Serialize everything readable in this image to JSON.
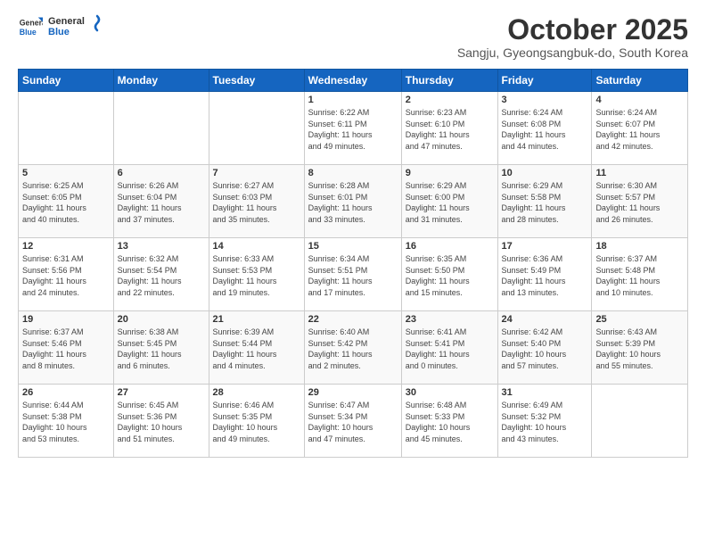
{
  "header": {
    "logo_general": "General",
    "logo_blue": "Blue",
    "month": "October 2025",
    "location": "Sangju, Gyeongsangbuk-do, South Korea"
  },
  "weekdays": [
    "Sunday",
    "Monday",
    "Tuesday",
    "Wednesday",
    "Thursday",
    "Friday",
    "Saturday"
  ],
  "weeks": [
    [
      {
        "day": "",
        "info": ""
      },
      {
        "day": "",
        "info": ""
      },
      {
        "day": "",
        "info": ""
      },
      {
        "day": "1",
        "info": "Sunrise: 6:22 AM\nSunset: 6:11 PM\nDaylight: 11 hours\nand 49 minutes."
      },
      {
        "day": "2",
        "info": "Sunrise: 6:23 AM\nSunset: 6:10 PM\nDaylight: 11 hours\nand 47 minutes."
      },
      {
        "day": "3",
        "info": "Sunrise: 6:24 AM\nSunset: 6:08 PM\nDaylight: 11 hours\nand 44 minutes."
      },
      {
        "day": "4",
        "info": "Sunrise: 6:24 AM\nSunset: 6:07 PM\nDaylight: 11 hours\nand 42 minutes."
      }
    ],
    [
      {
        "day": "5",
        "info": "Sunrise: 6:25 AM\nSunset: 6:05 PM\nDaylight: 11 hours\nand 40 minutes."
      },
      {
        "day": "6",
        "info": "Sunrise: 6:26 AM\nSunset: 6:04 PM\nDaylight: 11 hours\nand 37 minutes."
      },
      {
        "day": "7",
        "info": "Sunrise: 6:27 AM\nSunset: 6:03 PM\nDaylight: 11 hours\nand 35 minutes."
      },
      {
        "day": "8",
        "info": "Sunrise: 6:28 AM\nSunset: 6:01 PM\nDaylight: 11 hours\nand 33 minutes."
      },
      {
        "day": "9",
        "info": "Sunrise: 6:29 AM\nSunset: 6:00 PM\nDaylight: 11 hours\nand 31 minutes."
      },
      {
        "day": "10",
        "info": "Sunrise: 6:29 AM\nSunset: 5:58 PM\nDaylight: 11 hours\nand 28 minutes."
      },
      {
        "day": "11",
        "info": "Sunrise: 6:30 AM\nSunset: 5:57 PM\nDaylight: 11 hours\nand 26 minutes."
      }
    ],
    [
      {
        "day": "12",
        "info": "Sunrise: 6:31 AM\nSunset: 5:56 PM\nDaylight: 11 hours\nand 24 minutes."
      },
      {
        "day": "13",
        "info": "Sunrise: 6:32 AM\nSunset: 5:54 PM\nDaylight: 11 hours\nand 22 minutes."
      },
      {
        "day": "14",
        "info": "Sunrise: 6:33 AM\nSunset: 5:53 PM\nDaylight: 11 hours\nand 19 minutes."
      },
      {
        "day": "15",
        "info": "Sunrise: 6:34 AM\nSunset: 5:51 PM\nDaylight: 11 hours\nand 17 minutes."
      },
      {
        "day": "16",
        "info": "Sunrise: 6:35 AM\nSunset: 5:50 PM\nDaylight: 11 hours\nand 15 minutes."
      },
      {
        "day": "17",
        "info": "Sunrise: 6:36 AM\nSunset: 5:49 PM\nDaylight: 11 hours\nand 13 minutes."
      },
      {
        "day": "18",
        "info": "Sunrise: 6:37 AM\nSunset: 5:48 PM\nDaylight: 11 hours\nand 10 minutes."
      }
    ],
    [
      {
        "day": "19",
        "info": "Sunrise: 6:37 AM\nSunset: 5:46 PM\nDaylight: 11 hours\nand 8 minutes."
      },
      {
        "day": "20",
        "info": "Sunrise: 6:38 AM\nSunset: 5:45 PM\nDaylight: 11 hours\nand 6 minutes."
      },
      {
        "day": "21",
        "info": "Sunrise: 6:39 AM\nSunset: 5:44 PM\nDaylight: 11 hours\nand 4 minutes."
      },
      {
        "day": "22",
        "info": "Sunrise: 6:40 AM\nSunset: 5:42 PM\nDaylight: 11 hours\nand 2 minutes."
      },
      {
        "day": "23",
        "info": "Sunrise: 6:41 AM\nSunset: 5:41 PM\nDaylight: 11 hours\nand 0 minutes."
      },
      {
        "day": "24",
        "info": "Sunrise: 6:42 AM\nSunset: 5:40 PM\nDaylight: 10 hours\nand 57 minutes."
      },
      {
        "day": "25",
        "info": "Sunrise: 6:43 AM\nSunset: 5:39 PM\nDaylight: 10 hours\nand 55 minutes."
      }
    ],
    [
      {
        "day": "26",
        "info": "Sunrise: 6:44 AM\nSunset: 5:38 PM\nDaylight: 10 hours\nand 53 minutes."
      },
      {
        "day": "27",
        "info": "Sunrise: 6:45 AM\nSunset: 5:36 PM\nDaylight: 10 hours\nand 51 minutes."
      },
      {
        "day": "28",
        "info": "Sunrise: 6:46 AM\nSunset: 5:35 PM\nDaylight: 10 hours\nand 49 minutes."
      },
      {
        "day": "29",
        "info": "Sunrise: 6:47 AM\nSunset: 5:34 PM\nDaylight: 10 hours\nand 47 minutes."
      },
      {
        "day": "30",
        "info": "Sunrise: 6:48 AM\nSunset: 5:33 PM\nDaylight: 10 hours\nand 45 minutes."
      },
      {
        "day": "31",
        "info": "Sunrise: 6:49 AM\nSunset: 5:32 PM\nDaylight: 10 hours\nand 43 minutes."
      },
      {
        "day": "",
        "info": ""
      }
    ]
  ]
}
